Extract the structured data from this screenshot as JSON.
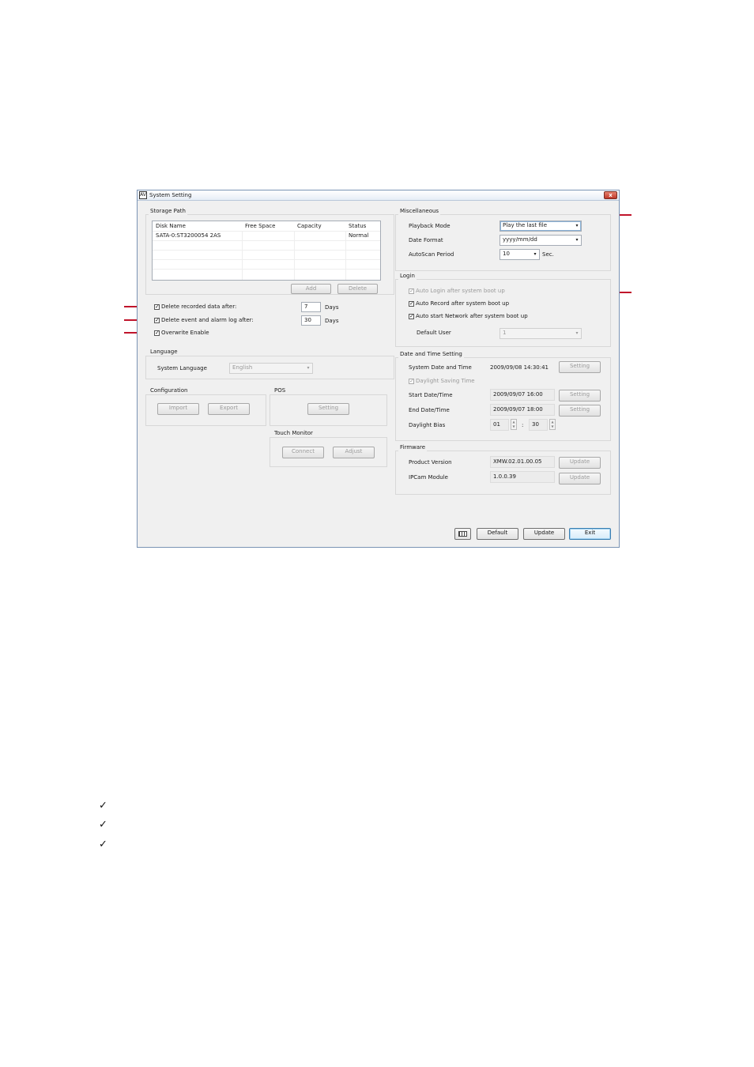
{
  "window": {
    "title": "System Setting",
    "close_label": "x",
    "icon_label": "AV"
  },
  "storage": {
    "title": "Storage Path",
    "columns": [
      "Disk Name",
      "Free Space",
      "Capacity",
      "Status"
    ],
    "rows": [
      {
        "disk": "SATA-0:ST3200054 2AS",
        "free": "",
        "capacity": "",
        "status": "Normal"
      }
    ],
    "add_label": "Add",
    "delete_label": "Delete",
    "delete_recorded_label": "Delete recorded data after:",
    "delete_recorded_value": "7",
    "delete_recorded_unit": "Days",
    "delete_event_label": "Delete event and alarm log after:",
    "delete_event_value": "30",
    "delete_event_unit": "Days",
    "overwrite_label": "Overwrite Enable"
  },
  "language": {
    "title": "Language",
    "label": "System Language",
    "value": "English"
  },
  "configuration": {
    "title": "Configuration",
    "import_label": "Import",
    "export_label": "Export"
  },
  "pos": {
    "title": "POS",
    "setting_label": "Setting"
  },
  "touch": {
    "title": "Touch Monitor",
    "connect_label": "Connect",
    "adjust_label": "Adjust"
  },
  "misc": {
    "title": "Miscellaneous",
    "playback_label": "Playback Mode",
    "playback_value": "Play the last file",
    "date_format_label": "Date Format",
    "date_format_value": "yyyy/mm/dd",
    "autoscan_label": "AutoScan Period",
    "autoscan_value": "10",
    "autoscan_unit": "Sec."
  },
  "login": {
    "title": "Login",
    "auto_login_label": "Auto Login after system boot up",
    "auto_record_label": "Auto Record after system boot up",
    "auto_network_label": "Auto start Network after system boot up",
    "default_user_label": "Default User",
    "default_user_value": "1"
  },
  "datetime": {
    "title": "Date and Time Setting",
    "system_label": "System Date and Time",
    "system_value": "2009/09/08 14:30:41",
    "setting_label": "Setting",
    "dst_label": "Daylight Saving Time",
    "start_label": "Start Date/Time",
    "start_value": "2009/09/07 16:00",
    "end_label": "End Date/Time",
    "end_value": "2009/09/07 18:00",
    "bias_label": "Daylight Bias",
    "bias_hours": "01",
    "bias_sep": ":",
    "bias_minutes": "30"
  },
  "firmware": {
    "title": "Firmware",
    "product_label": "Product Version",
    "product_value": "XMW.02.01.00.05",
    "ipcam_label": "IPCam Module",
    "ipcam_value": "1.0.0.39",
    "update_label": "Update"
  },
  "footer": {
    "default_label": "Default",
    "update_label": "Update",
    "exit_label": "Exit"
  },
  "checkmarks": [
    "✓",
    "✓",
    "✓"
  ],
  "colors": {
    "annotation": "#c0142b",
    "window_bg": "#f0f0f0",
    "close_button": "#c0392b"
  }
}
